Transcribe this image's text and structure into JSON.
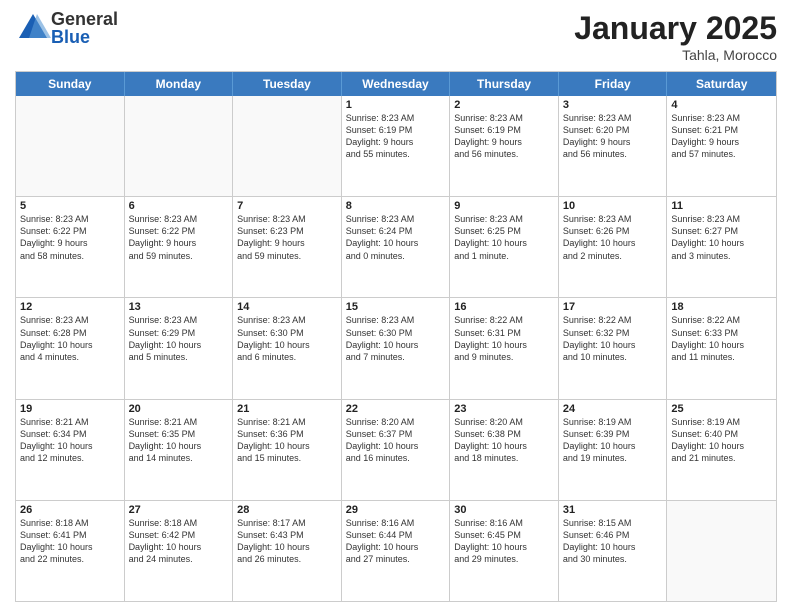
{
  "header": {
    "logo_general": "General",
    "logo_blue": "Blue",
    "title": "January 2025",
    "subtitle": "Tahla, Morocco"
  },
  "weekdays": [
    "Sunday",
    "Monday",
    "Tuesday",
    "Wednesday",
    "Thursday",
    "Friday",
    "Saturday"
  ],
  "rows": [
    [
      {
        "day": "",
        "info": ""
      },
      {
        "day": "",
        "info": ""
      },
      {
        "day": "",
        "info": ""
      },
      {
        "day": "1",
        "info": "Sunrise: 8:23 AM\nSunset: 6:19 PM\nDaylight: 9 hours\nand 55 minutes."
      },
      {
        "day": "2",
        "info": "Sunrise: 8:23 AM\nSunset: 6:19 PM\nDaylight: 9 hours\nand 56 minutes."
      },
      {
        "day": "3",
        "info": "Sunrise: 8:23 AM\nSunset: 6:20 PM\nDaylight: 9 hours\nand 56 minutes."
      },
      {
        "day": "4",
        "info": "Sunrise: 8:23 AM\nSunset: 6:21 PM\nDaylight: 9 hours\nand 57 minutes."
      }
    ],
    [
      {
        "day": "5",
        "info": "Sunrise: 8:23 AM\nSunset: 6:22 PM\nDaylight: 9 hours\nand 58 minutes."
      },
      {
        "day": "6",
        "info": "Sunrise: 8:23 AM\nSunset: 6:22 PM\nDaylight: 9 hours\nand 59 minutes."
      },
      {
        "day": "7",
        "info": "Sunrise: 8:23 AM\nSunset: 6:23 PM\nDaylight: 9 hours\nand 59 minutes."
      },
      {
        "day": "8",
        "info": "Sunrise: 8:23 AM\nSunset: 6:24 PM\nDaylight: 10 hours\nand 0 minutes."
      },
      {
        "day": "9",
        "info": "Sunrise: 8:23 AM\nSunset: 6:25 PM\nDaylight: 10 hours\nand 1 minute."
      },
      {
        "day": "10",
        "info": "Sunrise: 8:23 AM\nSunset: 6:26 PM\nDaylight: 10 hours\nand 2 minutes."
      },
      {
        "day": "11",
        "info": "Sunrise: 8:23 AM\nSunset: 6:27 PM\nDaylight: 10 hours\nand 3 minutes."
      }
    ],
    [
      {
        "day": "12",
        "info": "Sunrise: 8:23 AM\nSunset: 6:28 PM\nDaylight: 10 hours\nand 4 minutes."
      },
      {
        "day": "13",
        "info": "Sunrise: 8:23 AM\nSunset: 6:29 PM\nDaylight: 10 hours\nand 5 minutes."
      },
      {
        "day": "14",
        "info": "Sunrise: 8:23 AM\nSunset: 6:30 PM\nDaylight: 10 hours\nand 6 minutes."
      },
      {
        "day": "15",
        "info": "Sunrise: 8:23 AM\nSunset: 6:30 PM\nDaylight: 10 hours\nand 7 minutes."
      },
      {
        "day": "16",
        "info": "Sunrise: 8:22 AM\nSunset: 6:31 PM\nDaylight: 10 hours\nand 9 minutes."
      },
      {
        "day": "17",
        "info": "Sunrise: 8:22 AM\nSunset: 6:32 PM\nDaylight: 10 hours\nand 10 minutes."
      },
      {
        "day": "18",
        "info": "Sunrise: 8:22 AM\nSunset: 6:33 PM\nDaylight: 10 hours\nand 11 minutes."
      }
    ],
    [
      {
        "day": "19",
        "info": "Sunrise: 8:21 AM\nSunset: 6:34 PM\nDaylight: 10 hours\nand 12 minutes."
      },
      {
        "day": "20",
        "info": "Sunrise: 8:21 AM\nSunset: 6:35 PM\nDaylight: 10 hours\nand 14 minutes."
      },
      {
        "day": "21",
        "info": "Sunrise: 8:21 AM\nSunset: 6:36 PM\nDaylight: 10 hours\nand 15 minutes."
      },
      {
        "day": "22",
        "info": "Sunrise: 8:20 AM\nSunset: 6:37 PM\nDaylight: 10 hours\nand 16 minutes."
      },
      {
        "day": "23",
        "info": "Sunrise: 8:20 AM\nSunset: 6:38 PM\nDaylight: 10 hours\nand 18 minutes."
      },
      {
        "day": "24",
        "info": "Sunrise: 8:19 AM\nSunset: 6:39 PM\nDaylight: 10 hours\nand 19 minutes."
      },
      {
        "day": "25",
        "info": "Sunrise: 8:19 AM\nSunset: 6:40 PM\nDaylight: 10 hours\nand 21 minutes."
      }
    ],
    [
      {
        "day": "26",
        "info": "Sunrise: 8:18 AM\nSunset: 6:41 PM\nDaylight: 10 hours\nand 22 minutes."
      },
      {
        "day": "27",
        "info": "Sunrise: 8:18 AM\nSunset: 6:42 PM\nDaylight: 10 hours\nand 24 minutes."
      },
      {
        "day": "28",
        "info": "Sunrise: 8:17 AM\nSunset: 6:43 PM\nDaylight: 10 hours\nand 26 minutes."
      },
      {
        "day": "29",
        "info": "Sunrise: 8:16 AM\nSunset: 6:44 PM\nDaylight: 10 hours\nand 27 minutes."
      },
      {
        "day": "30",
        "info": "Sunrise: 8:16 AM\nSunset: 6:45 PM\nDaylight: 10 hours\nand 29 minutes."
      },
      {
        "day": "31",
        "info": "Sunrise: 8:15 AM\nSunset: 6:46 PM\nDaylight: 10 hours\nand 30 minutes."
      },
      {
        "day": "",
        "info": ""
      }
    ]
  ]
}
